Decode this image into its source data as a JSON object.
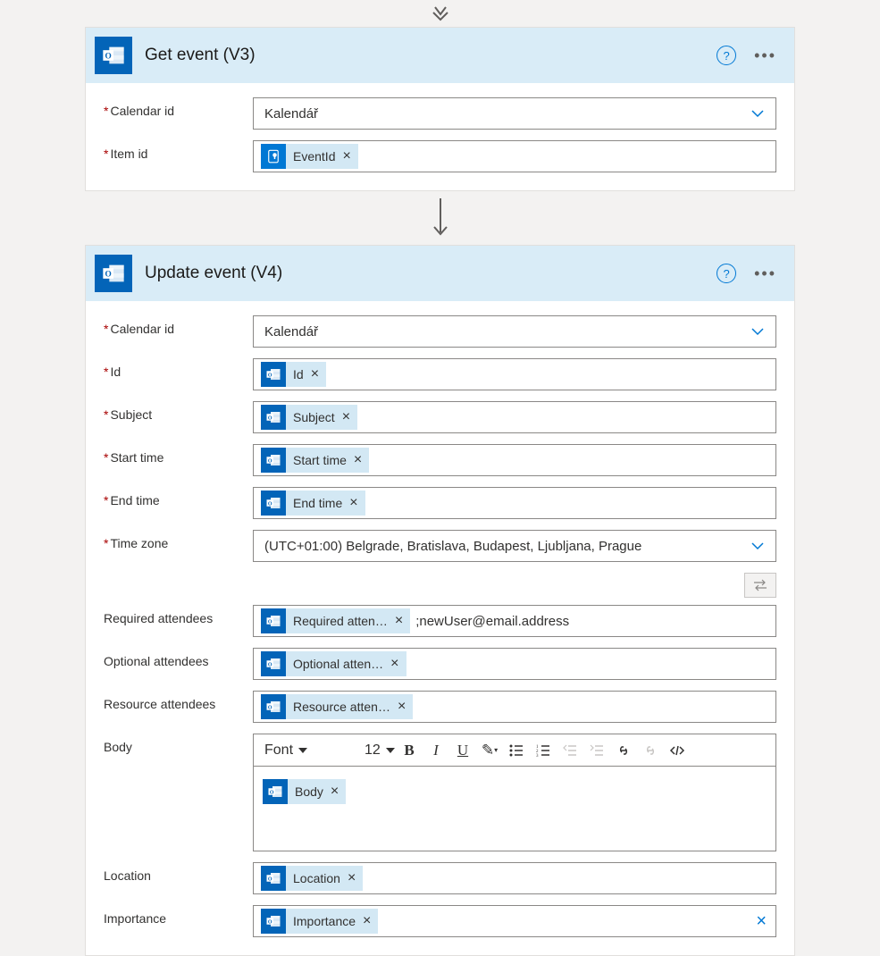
{
  "cards": {
    "get_event": {
      "title": "Get event (V3)",
      "fields": {
        "calendar_id": {
          "label": "Calendar id",
          "value": "Kalendář"
        },
        "item_id": {
          "label": "Item id",
          "token": "EventId"
        }
      }
    },
    "update_event": {
      "title": "Update event (V4)",
      "fields": {
        "calendar_id": {
          "label": "Calendar id",
          "value": "Kalendář"
        },
        "id": {
          "label": "Id",
          "token": "Id"
        },
        "subject": {
          "label": "Subject",
          "token": "Subject"
        },
        "start_time": {
          "label": "Start time",
          "token": "Start time"
        },
        "end_time": {
          "label": "End time",
          "token": "End time"
        },
        "time_zone": {
          "label": "Time zone",
          "value": "(UTC+01:00) Belgrade, Bratislava, Budapest, Ljubljana, Prague"
        },
        "required_attendees": {
          "label": "Required attendees",
          "token": "Required atten…",
          "extra": ";newUser@email.address"
        },
        "optional_attendees": {
          "label": "Optional attendees",
          "token": "Optional atten…"
        },
        "resource_attendees": {
          "label": "Resource attendees",
          "token": "Resource atten…"
        },
        "body": {
          "label": "Body",
          "token": "Body"
        },
        "location": {
          "label": "Location",
          "token": "Location"
        },
        "importance": {
          "label": "Importance",
          "token": "Importance"
        }
      },
      "rich_toolbar": {
        "font_label": "Font",
        "size_label": "12"
      }
    }
  }
}
